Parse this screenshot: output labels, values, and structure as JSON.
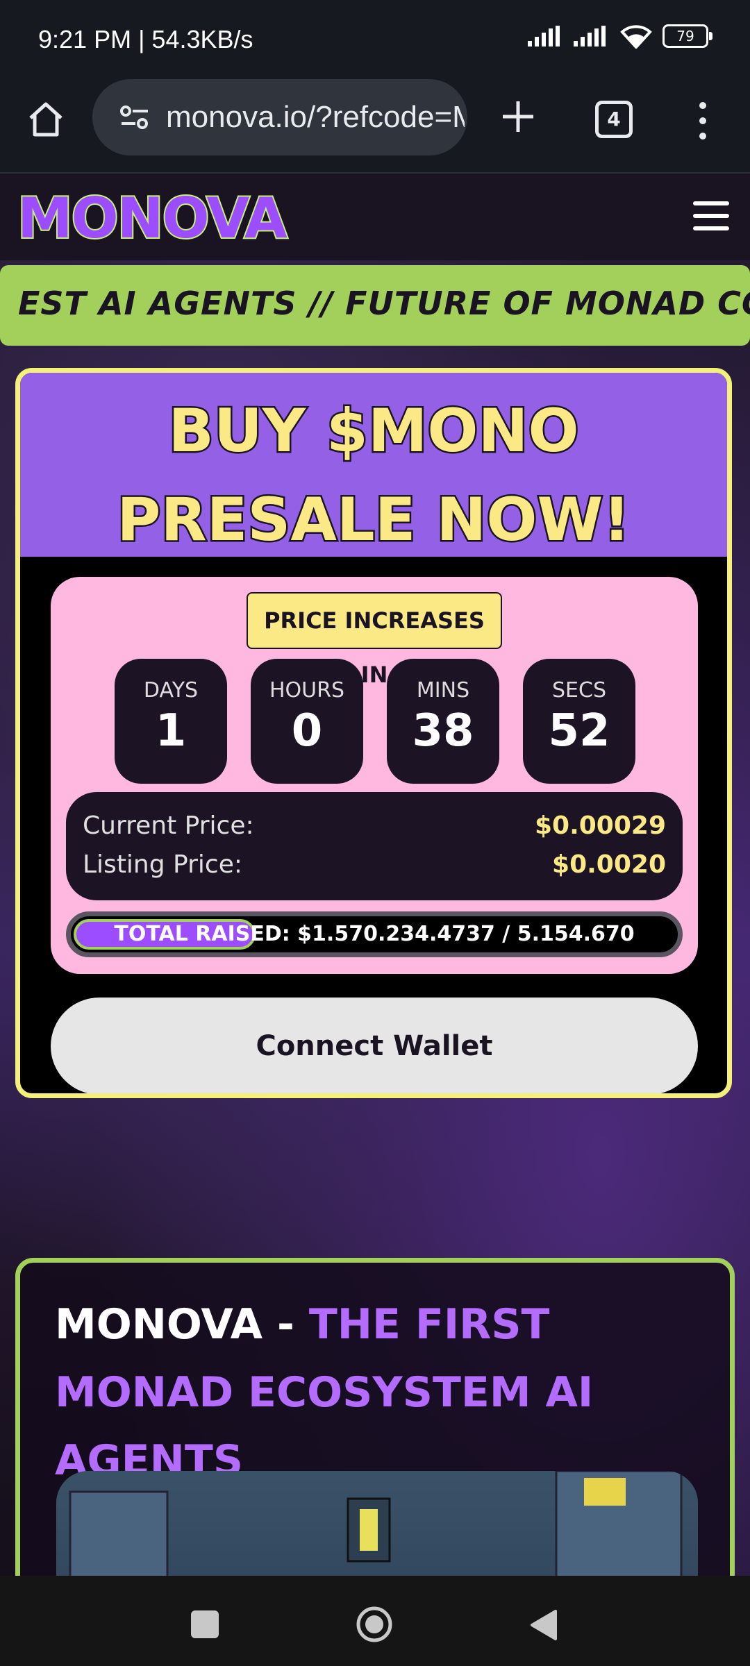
{
  "status_bar": {
    "time": "9:21 PM | 54.3KB/s",
    "battery": "79"
  },
  "browser": {
    "url": "monova.io/?refcode=M",
    "tab_count": "4"
  },
  "site": {
    "logo": "MONOVA",
    "ticker": "EST AI AGENTS // FUTURE OF MONAD COMMUNITY /"
  },
  "presale": {
    "title": "BUY $MONO PRESALE NOW!",
    "price_increase_label": "PRICE INCREASES IN",
    "timer": [
      {
        "label": "DAYS",
        "value": "1"
      },
      {
        "label": "HOURS",
        "value": "0"
      },
      {
        "label": "MINS",
        "value": "38"
      },
      {
        "label": "SECS",
        "value": "52"
      }
    ],
    "current_price_label": "Current Price:",
    "current_price": "$0.00029",
    "listing_price_label": "Listing Price:",
    "listing_price": "$0.0020",
    "total_raised_text": "TOTAL RAISED: $1.570.234.4737 / 5.154.670",
    "raised_fraction": 0.3,
    "connect_wallet": "Connect Wallet"
  },
  "section2": {
    "title_white": "MONOVA - ",
    "title_purple": "THE FIRST MONAD ECOSYSTEM AI AGENTS"
  },
  "colors": {
    "accent_purple": "#9360e6",
    "accent_green": "#a3d05a",
    "accent_yellow": "#fbe985",
    "pink_panel": "#ffb8e0"
  }
}
